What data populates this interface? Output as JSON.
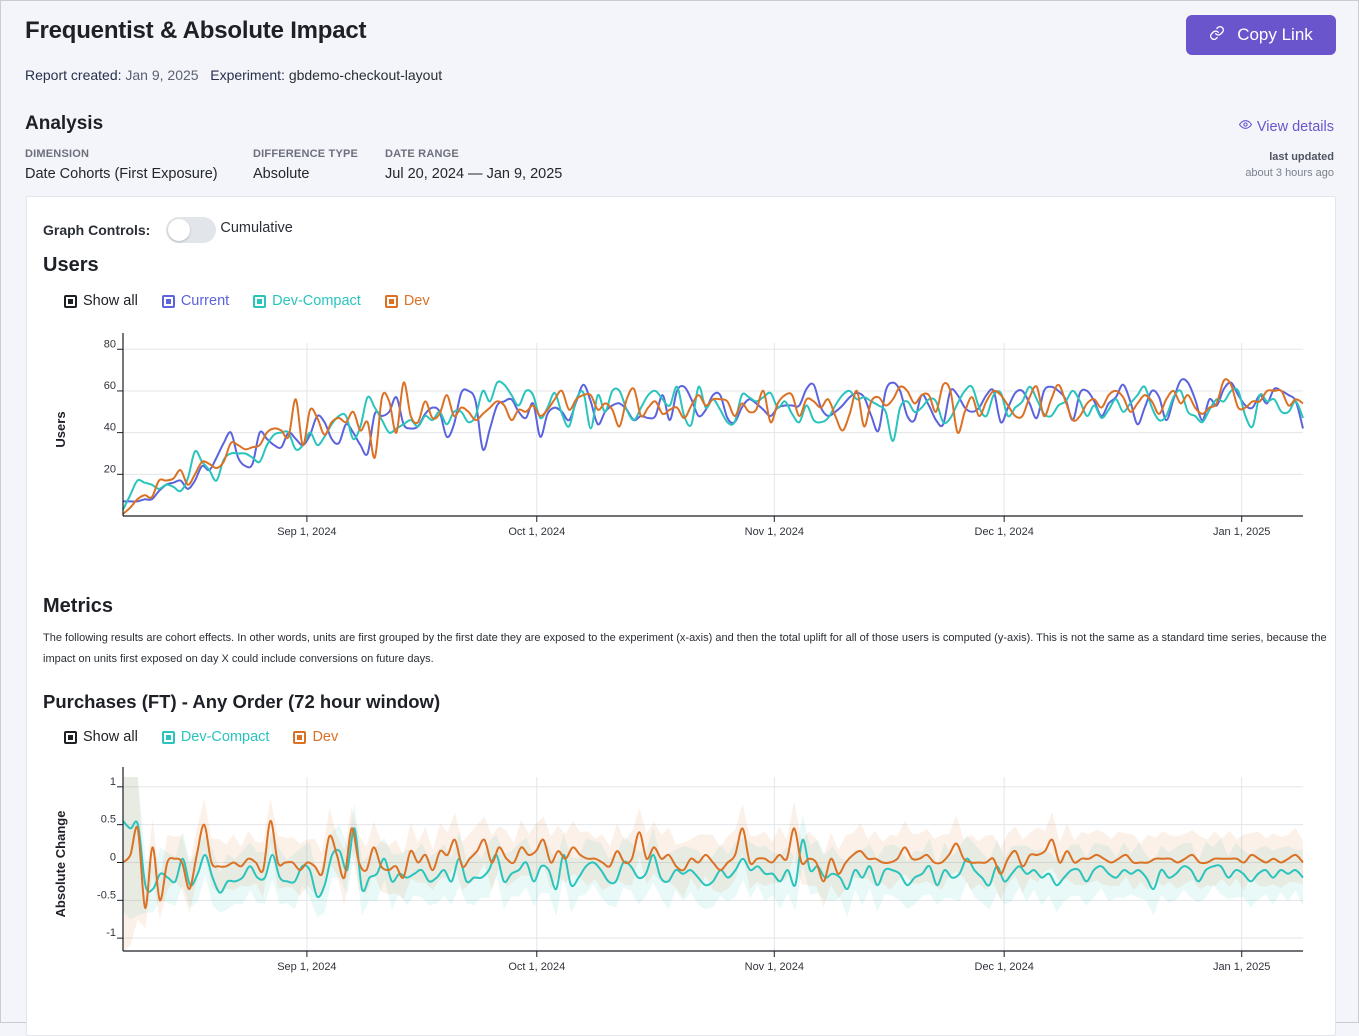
{
  "header": {
    "title": "Frequentist & Absolute Impact",
    "report_created_label": "Report created:",
    "report_created_value": "Jan 9, 2025",
    "experiment_label": "Experiment:",
    "experiment_value": "gbdemo-checkout-layout",
    "copy_link_label": "Copy Link",
    "copy_link_icon": "link-icon"
  },
  "analysis": {
    "title": "Analysis",
    "fields": [
      {
        "label": "Dimension",
        "value": "Date Cohorts (First Exposure)"
      },
      {
        "label": "Difference Type",
        "value": "Absolute"
      },
      {
        "label": "Date Range",
        "value": "Jul 20, 2024 — Jan 9, 2025"
      }
    ],
    "view_details_label": "View details",
    "view_details_icon": "eye-icon",
    "last_updated_label": "last updated",
    "last_updated_value": "about 3 hours ago"
  },
  "graph_controls": {
    "label": "Graph Controls:",
    "toggle_label": "Cumulative",
    "cumulative_on": false
  },
  "colors": {
    "accent": "#6a55cc",
    "current": "#5b63dd",
    "dev_compact": "#2ac4bd",
    "dev": "#db7124",
    "show_all": "#1d1f24"
  },
  "users_section": {
    "title": "Users",
    "legend": [
      {
        "label": "Show all",
        "color": "#1d1f24"
      },
      {
        "label": "Current",
        "color": "#5b63dd"
      },
      {
        "label": "Dev-Compact",
        "color": "#2ac4bd"
      },
      {
        "label": "Dev",
        "color": "#db7124"
      }
    ]
  },
  "metrics_section": {
    "title": "Metrics",
    "description": "The following results are cohort effects. In other words, units are first grouped by the first date they are exposed to the experiment (x-axis) and then the total uplift for all of those users is computed (y-axis). This is not the same as a standard time series, because the impact on units first exposed on day X could include conversions on future days.",
    "metric_title": "Purchases (FT) - Any Order (72 hour window)",
    "legend": [
      {
        "label": "Show all",
        "color": "#1d1f24"
      },
      {
        "label": "Dev-Compact",
        "color": "#2ac4bd"
      },
      {
        "label": "Dev",
        "color": "#db7124"
      }
    ]
  },
  "chart_data": [
    {
      "type": "line",
      "title": "Users",
      "xlabel": "",
      "ylabel": "Users",
      "x_start": "2024-08-08",
      "x_end": "2025-01-09",
      "x_ticks": [
        "Sep 1, 2024",
        "Oct 1, 2024",
        "Nov 1, 2024",
        "Dec 1, 2024",
        "Jan 1, 2025"
      ],
      "x_tick_dates": [
        "2024-09-01",
        "2024-10-01",
        "2024-11-01",
        "2024-12-01",
        "2025-01-01"
      ],
      "y_ticks": [
        20,
        40,
        60,
        80
      ],
      "ylim": [
        0,
        83
      ],
      "grid": true,
      "series": [
        {
          "name": "Current",
          "color": "#5b63dd",
          "values": [
            7,
            7,
            7,
            8,
            8,
            12,
            15,
            16,
            17,
            13,
            17,
            24,
            22,
            28,
            35,
            40,
            28,
            24,
            25,
            40,
            37,
            34,
            33,
            40,
            37,
            34,
            39,
            48,
            45,
            37,
            35,
            44,
            40,
            34,
            30,
            49,
            48,
            50,
            57,
            44,
            42,
            43,
            49,
            52,
            50,
            38,
            44,
            59,
            60,
            55,
            32,
            42,
            53,
            55,
            56,
            50,
            47,
            54,
            38,
            49,
            52,
            50,
            46,
            55,
            63,
            55,
            44,
            50,
            53,
            54,
            51,
            46,
            48,
            47,
            48,
            58,
            46,
            60,
            62,
            56,
            48,
            51,
            58,
            58,
            47,
            45,
            52,
            56,
            54,
            51,
            48,
            52,
            53,
            53,
            53,
            61,
            63,
            52,
            48,
            50,
            53,
            57,
            59,
            57,
            48,
            41,
            60,
            64,
            60,
            48,
            46,
            58,
            53,
            46,
            44,
            60,
            58,
            52,
            50,
            52,
            58,
            60,
            45,
            52,
            59,
            60,
            54,
            47,
            60,
            62,
            60,
            56,
            46,
            59,
            60,
            55,
            48,
            54,
            57,
            63,
            55,
            44,
            52,
            60,
            57,
            46,
            56,
            65,
            64,
            56,
            46,
            56,
            53,
            61,
            64,
            58,
            53,
            52,
            58,
            54,
            61,
            60,
            58,
            55,
            42
          ]
        },
        {
          "name": "Dev-Compact",
          "color": "#2ac4bd",
          "values": [
            3,
            10,
            17,
            16,
            15,
            13,
            15,
            14,
            12,
            18,
            31,
            26,
            22,
            17,
            27,
            30,
            30,
            30,
            28,
            26,
            34,
            39,
            40,
            40,
            32,
            34,
            40,
            34,
            38,
            44,
            48,
            48,
            37,
            43,
            57,
            52,
            46,
            40,
            42,
            44,
            46,
            43,
            48,
            46,
            50,
            44,
            50,
            50,
            45,
            48,
            60,
            55,
            64,
            63,
            58,
            53,
            60,
            58,
            47,
            52,
            59,
            49,
            43,
            56,
            59,
            42,
            58,
            50,
            60,
            60,
            51,
            46,
            52,
            58,
            60,
            56,
            53,
            62,
            48,
            44,
            62,
            52,
            56,
            51,
            45,
            45,
            58,
            57,
            55,
            57,
            59,
            52,
            55,
            49,
            45,
            53,
            46,
            45,
            47,
            53,
            58,
            60,
            56,
            57,
            55,
            53,
            50,
            36,
            52,
            55,
            50,
            52,
            56,
            55,
            45,
            47,
            54,
            60,
            62,
            52,
            48,
            58,
            59,
            48,
            52,
            55,
            62,
            56,
            49,
            48,
            53,
            55,
            60,
            55,
            48,
            53,
            47,
            51,
            56,
            50,
            54,
            58,
            62,
            52,
            46,
            48,
            57,
            60,
            50,
            48,
            45,
            51,
            56,
            55,
            60,
            60,
            48,
            43,
            58,
            55,
            56,
            50,
            50,
            55,
            47
          ]
        },
        {
          "name": "Dev",
          "color": "#db7124",
          "values": [
            1,
            4,
            8,
            10,
            9,
            17,
            17,
            18,
            22,
            15,
            20,
            26,
            25,
            23,
            26,
            35,
            34,
            32,
            33,
            34,
            40,
            42,
            41,
            38,
            56,
            34,
            51,
            47,
            39,
            45,
            47,
            45,
            50,
            41,
            45,
            28,
            57,
            55,
            40,
            64,
            48,
            45,
            55,
            47,
            49,
            58,
            48,
            52,
            50,
            46,
            49,
            52,
            55,
            53,
            46,
            51,
            50,
            53,
            48,
            51,
            56,
            60,
            51,
            56,
            58,
            58,
            51,
            54,
            51,
            43,
            56,
            61,
            48,
            52,
            55,
            49,
            51,
            52,
            47,
            53,
            58,
            53,
            56,
            56,
            55,
            48,
            54,
            50,
            51,
            60,
            45,
            54,
            58,
            58,
            48,
            56,
            55,
            52,
            56,
            48,
            41,
            49,
            60,
            43,
            55,
            57,
            53,
            56,
            62,
            60,
            54,
            58,
            58,
            50,
            63,
            60,
            40,
            50,
            57,
            48,
            55,
            60,
            58,
            53,
            48,
            48,
            57,
            62,
            48,
            56,
            63,
            55,
            46,
            48,
            54,
            56,
            52,
            58,
            60,
            57,
            50,
            54,
            58,
            55,
            49,
            56,
            60,
            54,
            58,
            52,
            49,
            52,
            54,
            65,
            63,
            52,
            52,
            55,
            55,
            60,
            60,
            60,
            53,
            56,
            54
          ]
        }
      ]
    },
    {
      "type": "line",
      "title": "Purchases (FT) - Any Order (72 hour window)",
      "xlabel": "",
      "ylabel": "Absolute Change",
      "x_start": "2024-08-08",
      "x_end": "2025-01-09",
      "x_ticks": [
        "Sep 1, 2024",
        "Oct 1, 2024",
        "Nov 1, 2024",
        "Dec 1, 2024",
        "Jan 1, 2025"
      ],
      "x_tick_dates": [
        "2024-09-01",
        "2024-10-01",
        "2024-11-01",
        "2024-12-01",
        "2025-01-01"
      ],
      "y_ticks": [
        -1,
        -0.5,
        0,
        0.5,
        1
      ],
      "ylim": [
        -1.17,
        1.13
      ],
      "grid": true,
      "confidence_bands": true,
      "series": [
        {
          "name": "Dev-Compact",
          "color": "#2ac4bd",
          "values": [
            0.55,
            0.45,
            0.5,
            -0.3,
            -0.35,
            -0.15,
            -0.2,
            -0.25,
            0.05,
            -0.3,
            -0.15,
            0.1,
            -0.2,
            -0.4,
            -0.25,
            -0.25,
            -0.2,
            -0.05,
            -0.2,
            -0.2,
            0.1,
            -0.2,
            -0.25,
            -0.25,
            -0.05,
            -0.1,
            -0.45,
            -0.3,
            0.1,
            0.15,
            -0.1,
            0.45,
            -0.35,
            -0.2,
            -0.15,
            0.05,
            -0.25,
            -0.15,
            -0.2,
            -0.15,
            -0.1,
            -0.25,
            -0.2,
            -0.1,
            -0.25,
            0.05,
            -0.25,
            -0.2,
            -0.2,
            -0.1,
            0.1,
            -0.25,
            -0.15,
            -0.1,
            0.0,
            -0.25,
            -0.05,
            -0.1,
            -0.35,
            0.1,
            -0.3,
            -0.2,
            -0.05,
            0.0,
            -0.1,
            -0.25,
            -0.25,
            0.0,
            -0.05,
            -0.2,
            -0.15,
            0.1,
            -0.2,
            -0.25,
            -0.1,
            -0.15,
            -0.1,
            -0.2,
            -0.3,
            -0.25,
            -0.1,
            -0.2,
            -0.1,
            0.05,
            -0.1,
            -0.05,
            -0.15,
            -0.15,
            -0.25,
            -0.1,
            -0.3,
            0.3,
            -0.1,
            -0.05,
            -0.2,
            -0.15,
            -0.2,
            -0.35,
            -0.1,
            -0.2,
            -0.05,
            -0.3,
            -0.1,
            -0.1,
            -0.15,
            -0.3,
            -0.2,
            -0.15,
            -0.05,
            -0.3,
            -0.1,
            -0.2,
            -0.15,
            0.05,
            -0.1,
            -0.2,
            -0.3,
            -0.05,
            -0.25,
            -0.15,
            -0.05,
            -0.15,
            -0.1,
            -0.2,
            -0.15,
            -0.3,
            -0.2,
            -0.1,
            -0.1,
            -0.25,
            -0.1,
            -0.05,
            -0.15,
            -0.2,
            -0.1,
            -0.15,
            -0.1,
            -0.2,
            -0.35,
            -0.1,
            -0.2,
            -0.15,
            -0.05,
            -0.1,
            -0.25,
            -0.1,
            -0.05,
            -0.05,
            -0.2,
            -0.1,
            -0.15,
            -0.25,
            -0.15,
            -0.1,
            -0.2,
            -0.1,
            -0.15,
            -0.1,
            -0.2
          ]
        },
        {
          "name": "Dev",
          "color": "#db7124",
          "values": [
            0.0,
            0.1,
            0.45,
            -0.6,
            0.2,
            -0.5,
            0.0,
            0.05,
            0.0,
            -0.35,
            0.1,
            0.5,
            0.0,
            -0.05,
            -0.05,
            0.0,
            -0.05,
            0.05,
            0.0,
            -0.1,
            0.55,
            0.0,
            0.0,
            0.0,
            -0.1,
            0.0,
            -0.05,
            -0.15,
            0.35,
            0.1,
            -0.2,
            0.45,
            0.0,
            -0.1,
            0.2,
            -0.05,
            -0.1,
            -0.05,
            -0.2,
            0.15,
            0.0,
            0.1,
            -0.1,
            0.15,
            0.1,
            0.3,
            -0.05,
            0.05,
            0.15,
            0.3,
            0.0,
            0.2,
            0.05,
            0.0,
            0.2,
            0.1,
            0.15,
            0.3,
            0.0,
            0.15,
            0.05,
            0.2,
            0.1,
            0.05,
            0.05,
            0.0,
            -0.05,
            0.15,
            0.0,
            0.05,
            0.4,
            0.05,
            0.2,
            0.05,
            0.1,
            -0.05,
            -0.1,
            0.05,
            0.0,
            0.1,
            0.0,
            -0.1,
            0.0,
            0.1,
            0.45,
            0.0,
            0.05,
            0.05,
            0.0,
            0.1,
            0.05,
            0.45,
            0.0,
            0.05,
            0.0,
            -0.25,
            0.05,
            -0.15,
            0.0,
            0.1,
            0.15,
            0.05,
            0.05,
            0.0,
            0.0,
            0.05,
            0.2,
            0.05,
            0.05,
            0.1,
            0.0,
            0.0,
            0.1,
            0.25,
            0.05,
            0.0,
            0.0,
            0.0,
            0.05,
            -0.15,
            0.05,
            0.15,
            -0.05,
            0.1,
            0.1,
            0.15,
            0.3,
            0.0,
            0.15,
            0.0,
            0.05,
            0.05,
            0.1,
            0.05,
            0.0,
            0.05,
            0.1,
            0.0,
            0.0,
            0.0,
            0.05,
            0.05,
            0.05,
            0.0,
            0.05,
            0.1,
            0.0,
            0.0,
            0.05,
            0.05,
            0.05,
            0.05,
            0.0,
            0.1,
            0.05,
            0.0,
            0.05,
            0.0,
            0.05,
            0.1,
            0.0
          ]
        }
      ]
    }
  ]
}
